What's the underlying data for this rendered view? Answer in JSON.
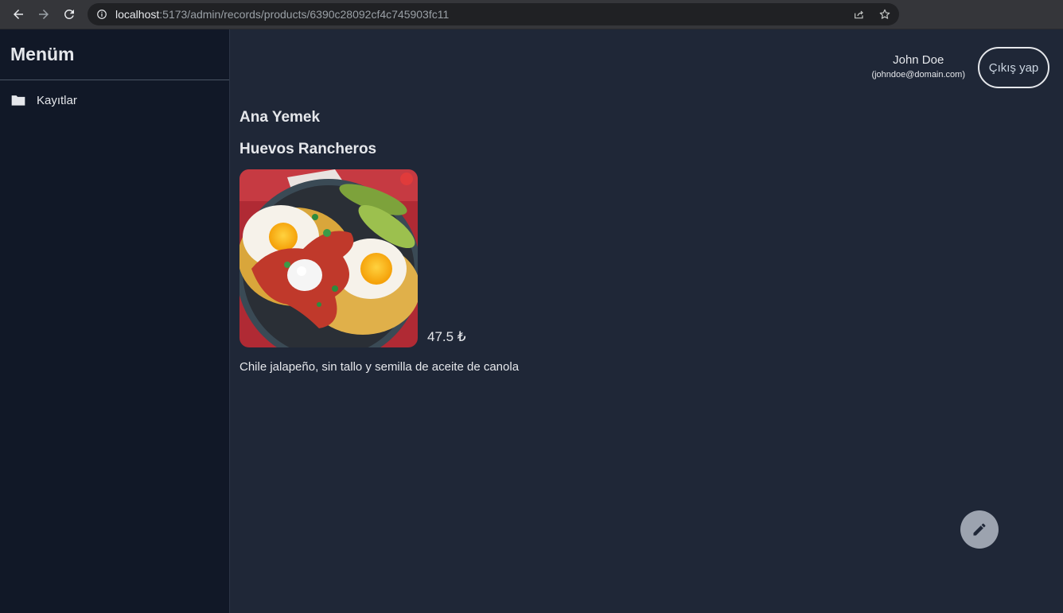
{
  "browser": {
    "url_host": "localhost",
    "url_path": ":5173/admin/records/products/6390c28092cf4c745903fc11"
  },
  "sidebar": {
    "title": "Menüm",
    "items": [
      {
        "label": "Kayıtlar",
        "icon": "folder-icon"
      }
    ]
  },
  "user": {
    "name": "John Doe",
    "email": "(johndoe@domain.com)",
    "logout_label": "Çıkış yap"
  },
  "product": {
    "category": "Ana Yemek",
    "name": "Huevos Rancheros",
    "price": "47.5 ₺",
    "description": "Chile jalapeño, sin tallo y semilla de aceite de canola",
    "image_alt": "huevos-rancheros-photo"
  },
  "actions": {
    "edit_icon": "pencil-icon"
  },
  "colors": {
    "sidebar_bg": "#111827",
    "main_bg": "#1f2737",
    "fab_bg": "#9ca3af"
  }
}
